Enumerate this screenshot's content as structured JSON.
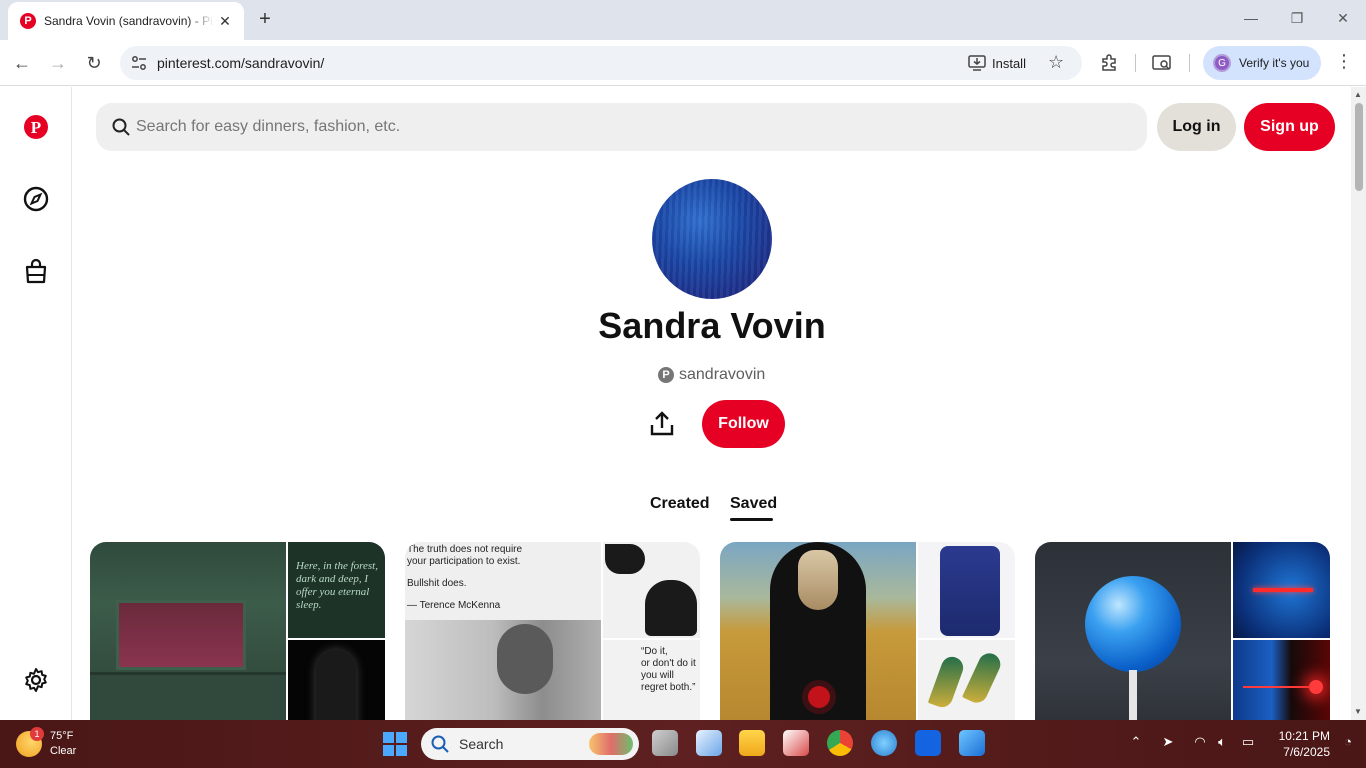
{
  "browser": {
    "tab_title": "Sandra Vovin (sandravovin) - Pinterest",
    "url": "pinterest.com/sandravovin/",
    "install_label": "Install",
    "verify_label": "Verify it's you",
    "verify_avatar_letter": "G"
  },
  "header": {
    "search_placeholder": "Search for easy dinners, fashion, etc.",
    "login_label": "Log in",
    "signup_label": "Sign up"
  },
  "profile": {
    "name": "Sandra Vovin",
    "handle": "sandravovin",
    "follow_label": "Follow"
  },
  "tabs": [
    {
      "label": "Created",
      "active": false
    },
    {
      "label": "Saved",
      "active": true
    }
  ],
  "boards": [
    {
      "overlay_text": "Here, in the forest, dark and deep, I offer you eternal sleep."
    },
    {
      "quote_lines": [
        "The truth does not require",
        "your participation to exist.",
        "",
        "Bullshit does.",
        "",
        "— Terence McKenna"
      ],
      "overlay_text_lines": [
        "“Do it,",
        "or don't do it",
        "you will",
        "regret both.”"
      ]
    },
    {},
    {}
  ],
  "taskbar": {
    "weather_temp": "75°F",
    "weather_cond": "Clear",
    "weather_badge": "1",
    "search_label": "Search",
    "time": "10:21 PM",
    "date": "7/6/2025"
  },
  "colors": {
    "brand_red": "#e60023",
    "login_bg": "#e2e0d9",
    "search_bg": "#efefef"
  },
  "icons": [
    "pinterest-logo-icon",
    "compass-icon",
    "shopping-bag-icon",
    "settings-gear-icon",
    "search-icon",
    "share-upload-icon"
  ]
}
